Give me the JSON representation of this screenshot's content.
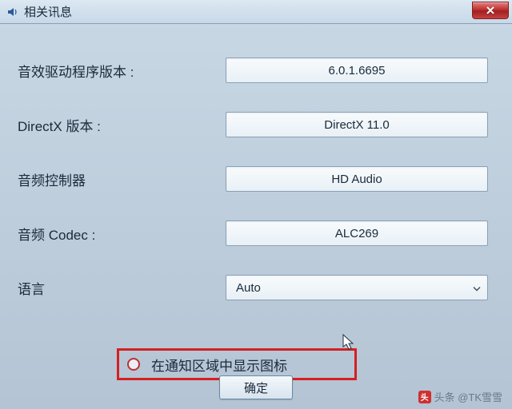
{
  "window": {
    "title": "相关讯息"
  },
  "fields": {
    "driver_version": {
      "label": "音效驱动程序版本 :",
      "value": "6.0.1.6695"
    },
    "directx_version": {
      "label": "DirectX 版本 :",
      "value": "DirectX 11.0"
    },
    "audio_controller": {
      "label": "音频控制器",
      "value": "HD Audio"
    },
    "audio_codec": {
      "label": "音频 Codec :",
      "value": "ALC269"
    },
    "language": {
      "label": "语言",
      "value": "Auto"
    }
  },
  "checkbox": {
    "label": "在通知区域中显示图标",
    "checked": false
  },
  "buttons": {
    "ok": "确定"
  },
  "attribution": "头条 @TK雪雪"
}
